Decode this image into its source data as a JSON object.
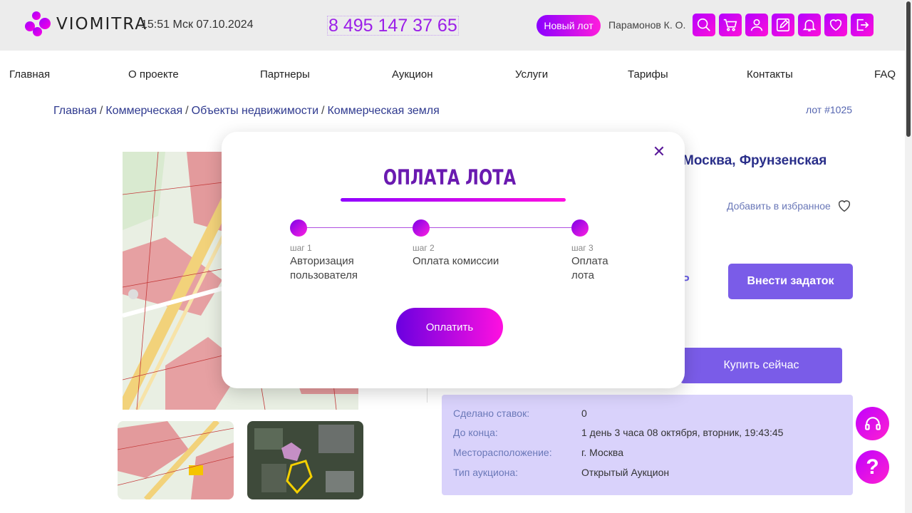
{
  "header": {
    "logo_text": "VIOMITRA",
    "clock": "15:51 Мск 07.10.2024",
    "phone": "8 495 147 37 65",
    "new_lot_label": "Новый лот",
    "user_name": "Парамонов К. О.",
    "icons": [
      "search-icon",
      "cart-icon",
      "user-icon",
      "edit-icon",
      "bell-icon",
      "heart-icon",
      "logout-icon"
    ]
  },
  "nav": [
    "Главная",
    "О проекте",
    "Партнеры",
    "Аукцион",
    "Услуги",
    "Тарифы",
    "Контакты",
    "FAQ"
  ],
  "breadcrumbs": [
    "Главная",
    "Коммерческая",
    "Объекты недвижимости",
    "Коммерческая земля"
  ],
  "lot_number": "лот #1025",
  "lot": {
    "title_visible": "Москва, Фрунзенская",
    "favorite_label": "Добавить в избранное",
    "price_fragment": "Р",
    "deposit_button": "Внести задаток",
    "buy_button": "Купить сейчас"
  },
  "info": [
    {
      "key": "Сделано ставок:",
      "value": "0"
    },
    {
      "key": "До конца:",
      "value": "1 день 3 часа 08 октября, вторник, 19:43:45"
    },
    {
      "key": "Месторасположение:",
      "value": "г. Москва"
    },
    {
      "key": "Тип аукциона:",
      "value": "Открытый Аукцион"
    }
  ],
  "modal": {
    "title": "ОПЛАТА ЛОТА",
    "close_icon": "close-icon",
    "steps": [
      {
        "label": "шаг 1",
        "text": "Авторизация пользователя"
      },
      {
        "label": "шаг 2",
        "text": "Оплата комиссии"
      },
      {
        "label": "шаг 3",
        "text": "Оплата лота"
      }
    ],
    "pay_button": "Оплатить"
  },
  "float_buttons": [
    "headset-icon",
    "question-icon"
  ],
  "colors": {
    "accent": "#a000ff",
    "accent2": "#ff10e0",
    "button": "#7a5ce8",
    "info_bg": "#d9d2fb"
  }
}
